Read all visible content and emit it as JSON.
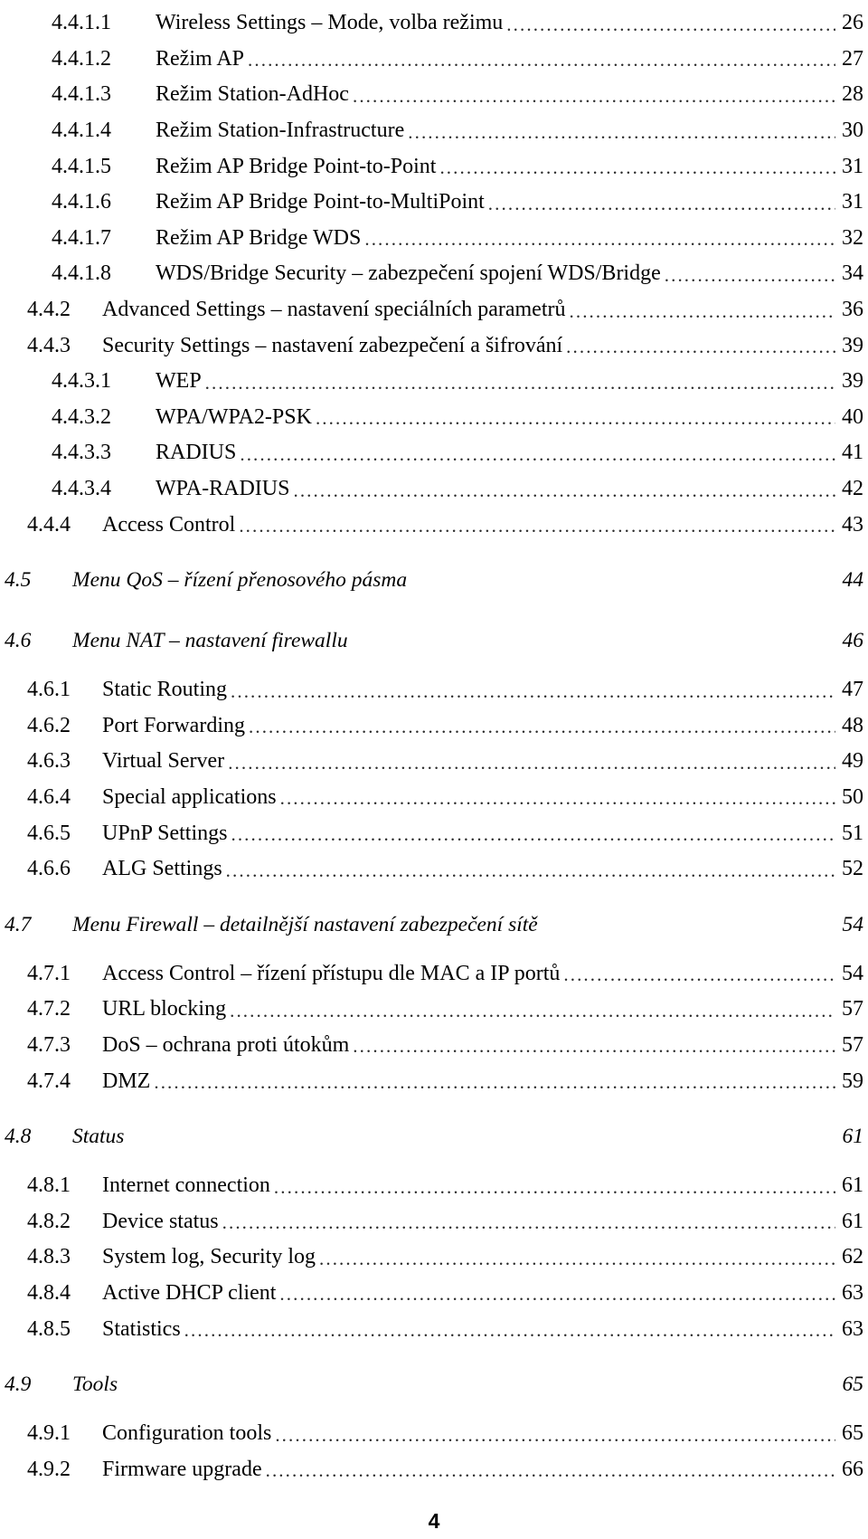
{
  "document": {
    "type": "table-of-contents",
    "language": "cs",
    "footer_page_number": "4"
  },
  "toc": {
    "entries": [
      {
        "level": 4,
        "number": "4.4.1.1",
        "label": "Wireless Settings – Mode, volba režimu",
        "page": "26"
      },
      {
        "level": 4,
        "number": "4.4.1.2",
        "label": "Režim AP",
        "page": "27"
      },
      {
        "level": 4,
        "number": "4.4.1.3",
        "label": "Režim Station-AdHoc",
        "page": "28"
      },
      {
        "level": 4,
        "number": "4.4.1.4",
        "label": "Režim Station-Infrastructure",
        "page": "30"
      },
      {
        "level": 4,
        "number": "4.4.1.5",
        "label": "Režim AP Bridge Point-to-Point",
        "page": "31"
      },
      {
        "level": 4,
        "number": "4.4.1.6",
        "label": "Režim AP Bridge Point-to-MultiPoint",
        "page": "31"
      },
      {
        "level": 4,
        "number": "4.4.1.7",
        "label": "Režim AP Bridge WDS",
        "page": "32"
      },
      {
        "level": 4,
        "number": "4.4.1.8",
        "label": "WDS/Bridge Security – zabezpečení spojení WDS/Bridge",
        "page": "34"
      },
      {
        "level": 3,
        "number": "4.4.2",
        "label": "Advanced Settings – nastavení speciálních parametrů",
        "page": "36"
      },
      {
        "level": 3,
        "number": "4.4.3",
        "label": "Security Settings – nastavení zabezpečení a šifrování",
        "page": "39"
      },
      {
        "level": 4,
        "number": "4.4.3.1",
        "label": "WEP",
        "page": "39"
      },
      {
        "level": 4,
        "number": "4.4.3.2",
        "label": "WPA/WPA2-PSK",
        "page": "40"
      },
      {
        "level": 4,
        "number": "4.4.3.3",
        "label": "RADIUS",
        "page": "41"
      },
      {
        "level": 4,
        "number": "4.4.3.4",
        "label": "WPA-RADIUS",
        "page": "42"
      },
      {
        "level": 3,
        "number": "4.4.4",
        "label": "Access Control",
        "page": "43"
      },
      {
        "level": 2,
        "number": "4.5",
        "label": "Menu QoS – řízení přenosového pásma",
        "page": "44"
      },
      {
        "level": 2,
        "number": "4.6",
        "label": "Menu NAT – nastavení firewallu",
        "page": "46"
      },
      {
        "level": 3,
        "number": "4.6.1",
        "label": "Static Routing",
        "page": "47"
      },
      {
        "level": 3,
        "number": "4.6.2",
        "label": "Port Forwarding",
        "page": "48"
      },
      {
        "level": 3,
        "number": "4.6.3",
        "label": "Virtual Server",
        "page": "49"
      },
      {
        "level": 3,
        "number": "4.6.4",
        "label": "Special applications",
        "page": "50"
      },
      {
        "level": 3,
        "number": "4.6.5",
        "label": "UPnP Settings",
        "page": "51"
      },
      {
        "level": 3,
        "number": "4.6.6",
        "label": "ALG Settings",
        "page": "52"
      },
      {
        "level": 2,
        "number": "4.7",
        "label": "Menu Firewall – detailnější nastavení zabezpečení sítě",
        "page": "54"
      },
      {
        "level": 3,
        "number": "4.7.1",
        "label": "Access Control – řízení přístupu dle MAC a  IP portů",
        "page": "54"
      },
      {
        "level": 3,
        "number": "4.7.2",
        "label": "URL blocking",
        "page": "57"
      },
      {
        "level": 3,
        "number": "4.7.3",
        "label": "DoS – ochrana proti útokům",
        "page": "57"
      },
      {
        "level": 3,
        "number": "4.7.4",
        "label": "DMZ",
        "page": "59"
      },
      {
        "level": 2,
        "number": "4.8",
        "label": "Status",
        "page": "61"
      },
      {
        "level": 3,
        "number": "4.8.1",
        "label": "Internet connection",
        "page": "61"
      },
      {
        "level": 3,
        "number": "4.8.2",
        "label": "Device status",
        "page": "61"
      },
      {
        "level": 3,
        "number": "4.8.3",
        "label": "System log, Security log",
        "page": "62"
      },
      {
        "level": 3,
        "number": "4.8.4",
        "label": "Active DHCP client",
        "page": "63"
      },
      {
        "level": 3,
        "number": "4.8.5",
        "label": "Statistics",
        "page": "63"
      },
      {
        "level": 2,
        "number": "4.9",
        "label": "Tools",
        "page": "65"
      },
      {
        "level": 3,
        "number": "4.9.1",
        "label": "Configuration tools",
        "page": "65"
      },
      {
        "level": 3,
        "number": "4.9.2",
        "label": "Firmware upgrade",
        "page": "66"
      }
    ]
  }
}
